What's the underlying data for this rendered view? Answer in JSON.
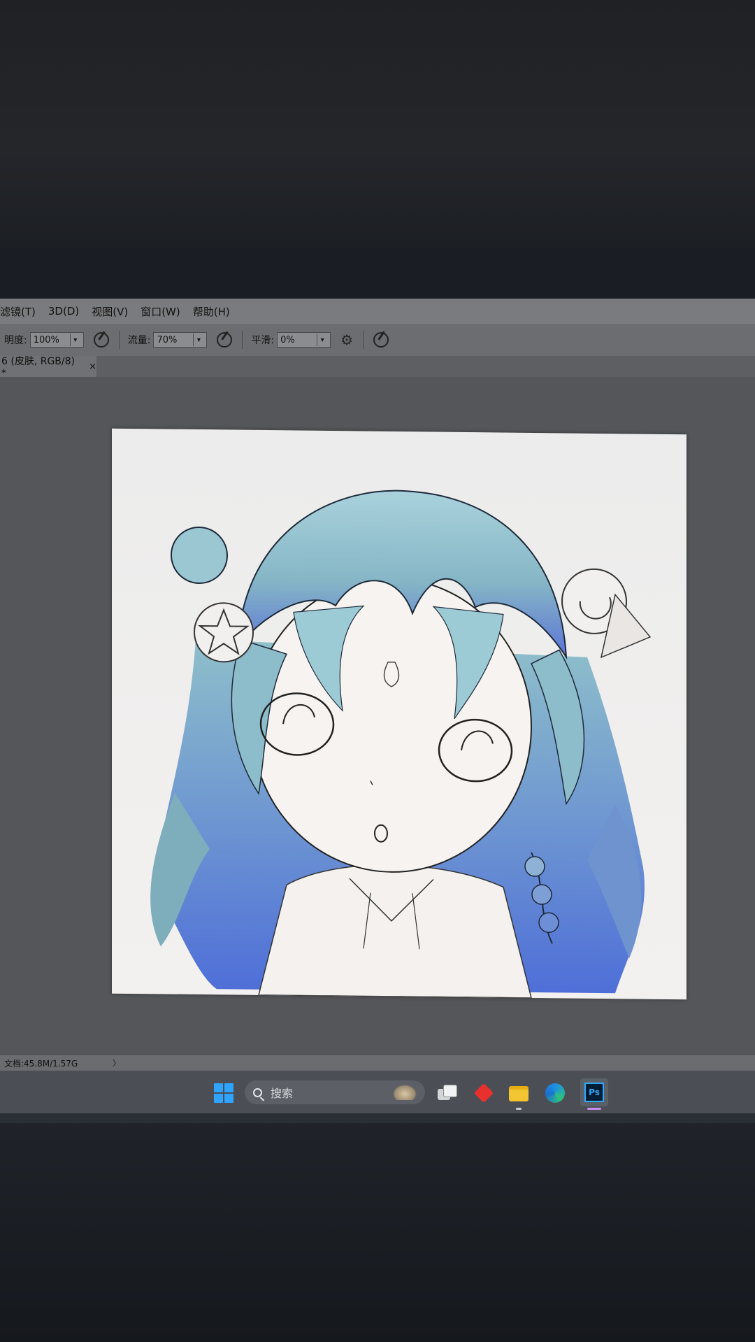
{
  "menu": {
    "items": [
      "滤镜(T)",
      "3D(D)",
      "视图(V)",
      "窗口(W)",
      "帮助(H)"
    ]
  },
  "options": {
    "opacity_label": "明度:",
    "opacity_value": "100%",
    "flow_label": "流量:",
    "flow_value": "70%",
    "smooth_label": "平滑:",
    "smooth_value": "0%"
  },
  "document": {
    "tab_title": "6 (皮肤, RGB/8) *",
    "tab_close": "×"
  },
  "status": {
    "doc_size": "文档:45.8M/1.57G",
    "arrow": "〉"
  },
  "taskbar": {
    "search_label": "搜索",
    "ps_label": "Ps"
  },
  "icons": [
    "brush-pressure-icon",
    "airbrush-icon",
    "gear-icon",
    "windows-start-icon",
    "search-icon",
    "task-view-icon",
    "git-icon",
    "file-explorer-icon",
    "edge-icon",
    "photoshop-icon"
  ],
  "colors": {
    "menubar": "#7a7b7e",
    "optionbar": "#6b6d70",
    "workspace": "#545659",
    "taskbar": "#4b4f55",
    "hair_blue": "#8fc0cf"
  }
}
